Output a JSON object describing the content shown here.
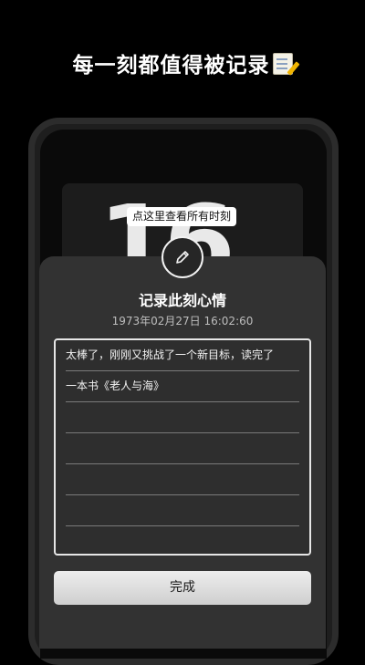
{
  "promo": {
    "headline": "每一刻都值得被记录"
  },
  "clock_card": {
    "number": "16",
    "tooltip": "点这里查看所有时刻"
  },
  "sheet": {
    "title": "记录此刻心情",
    "timestamp": "1973年02月27日 16:02:60",
    "note_lines": [
      "太棒了，刚刚又挑战了一个新目标，读完了",
      "一本书《老人与海》",
      "",
      "",
      "",
      ""
    ],
    "done_label": "完成"
  },
  "icons": {
    "edit": "pencil-icon",
    "headline_emoji": "memo-icon"
  },
  "colors": {
    "background": "#000000",
    "sheet": "#323232",
    "button": "#e0e0e0",
    "text": "#ffffff"
  }
}
